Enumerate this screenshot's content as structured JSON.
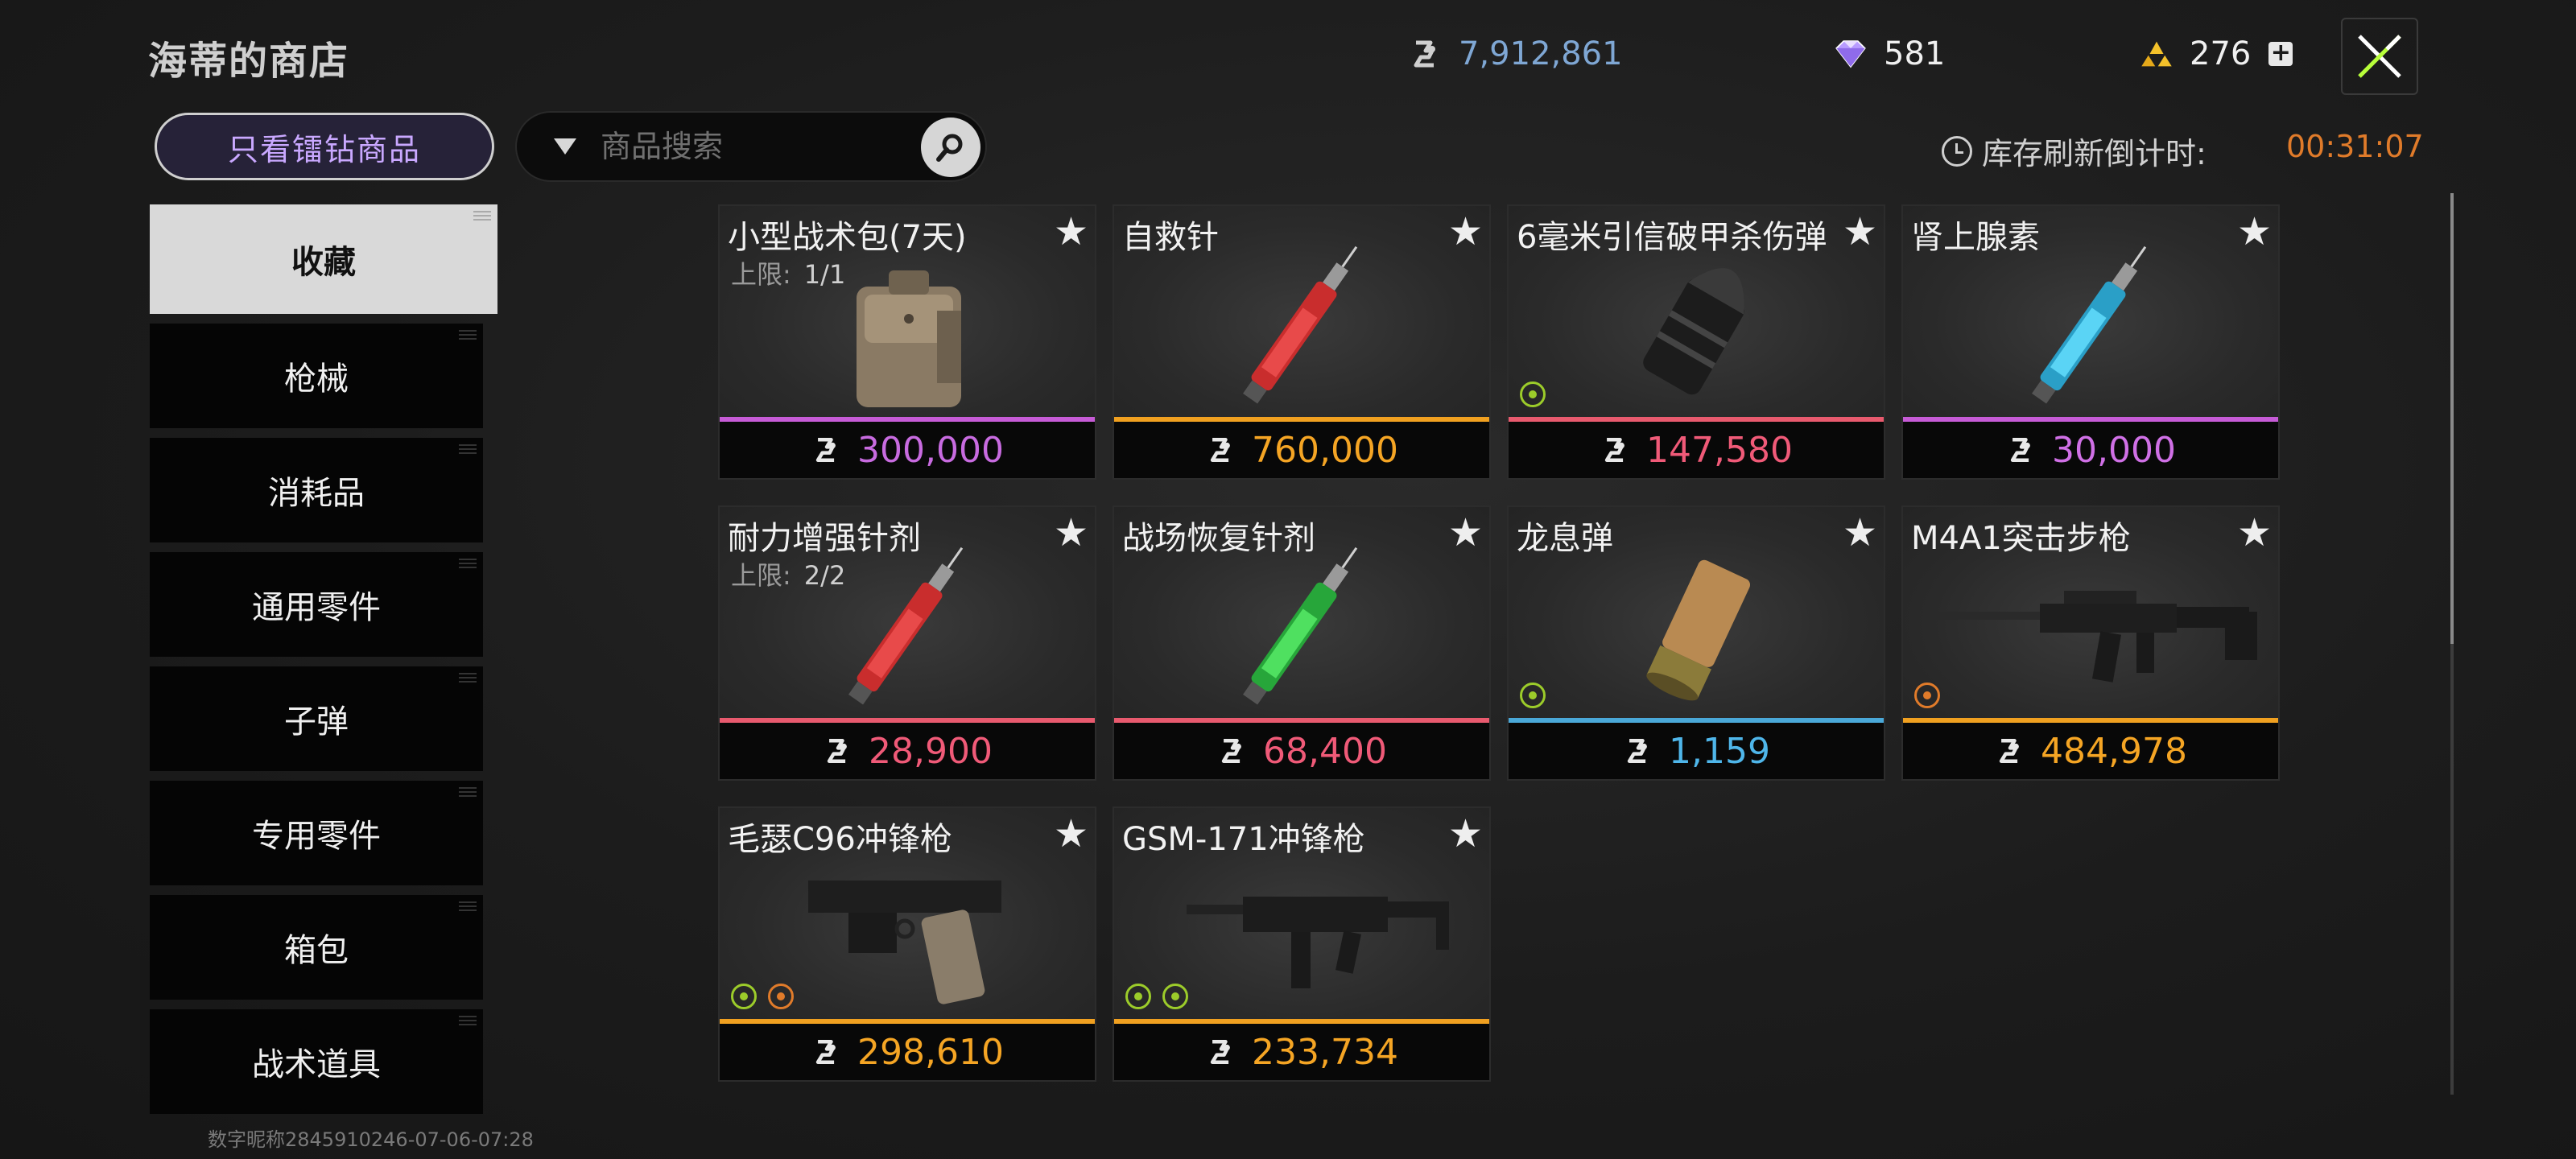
{
  "header": {
    "title": "海蒂的商店",
    "coins": "7,912,861",
    "gems": "581",
    "gold": "276"
  },
  "filter": {
    "only_diamond_label": "只看镭钻商品",
    "search_placeholder": "商品搜索",
    "refresh_label": "库存刷新倒计时:",
    "refresh_time": "00:31:07"
  },
  "sidebar": {
    "items": [
      {
        "label": "收藏",
        "active": true
      },
      {
        "label": "枪械"
      },
      {
        "label": "消耗品"
      },
      {
        "label": "通用零件"
      },
      {
        "label": "子弹"
      },
      {
        "label": "专用零件"
      },
      {
        "label": "箱包"
      },
      {
        "label": "战术道具"
      }
    ]
  },
  "items": [
    {
      "name": "小型战术包(7天)",
      "limit_label": "上限:",
      "limit": "1/1",
      "price": "300,000",
      "rarity_color": "#c65bd6",
      "price_color": "#c86be0",
      "icon": "tactical-pouch"
    },
    {
      "name": "自救针",
      "price": "760,000",
      "rarity_color": "#f0a020",
      "price_color": "#f5a524",
      "icon": "syringe-red"
    },
    {
      "name": "6毫米引信破甲杀伤弹",
      "price": "147,580",
      "rarity_color": "#e85a6e",
      "price_color": "#f05a78",
      "icon": "grenade-round"
    },
    {
      "name": "肾上腺素",
      "price": "30,000",
      "rarity_color": "#c65bd6",
      "price_color": "#d070e6",
      "icon": "syringe-blue"
    },
    {
      "name": "耐力增强针剂",
      "limit_label": "上限:",
      "limit": "2/2",
      "price": "28,900",
      "rarity_color": "#e85a6e",
      "price_color": "#f05a78",
      "icon": "syringe-red"
    },
    {
      "name": "战场恢复针剂",
      "price": "68,400",
      "rarity_color": "#e85a6e",
      "price_color": "#f05a78",
      "icon": "syringe-green"
    },
    {
      "name": "龙息弹",
      "price": "1,159",
      "rarity_color": "#4aa8d8",
      "price_color": "#4fb6ea",
      "icon": "shotgun-shell"
    },
    {
      "name": "M4A1突击步枪",
      "price": "484,978",
      "rarity_color": "#f0a020",
      "price_color": "#f5a524",
      "icon": "rifle"
    },
    {
      "name": "毛瑟C96冲锋枪",
      "price": "298,610",
      "rarity_color": "#f0a020",
      "price_color": "#f5a524",
      "icon": "pistol"
    },
    {
      "name": "GSM-171冲锋枪",
      "price": "233,734",
      "rarity_color": "#f0a020",
      "price_color": "#f5a524",
      "icon": "smg"
    }
  ],
  "footer": {
    "text": "数字昵称2845910246-07-06-07:28"
  }
}
